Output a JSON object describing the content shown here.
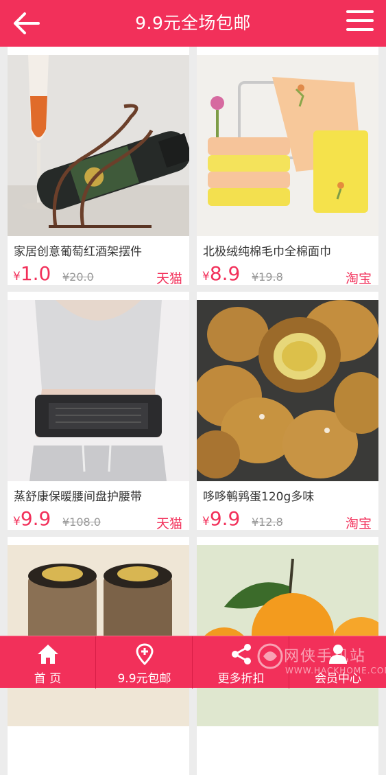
{
  "header": {
    "title": "9.9元全场包邮",
    "back_icon": "arrow-left-icon",
    "menu_icon": "hamburger-menu-icon"
  },
  "products": [
    {
      "name": "家居创意葡萄红酒架摆件",
      "currency": "¥",
      "price": "1.0",
      "old_price": "¥20.0",
      "shop": "天猫"
    },
    {
      "name": "北极绒纯棉毛巾全棉面巾",
      "currency": "¥",
      "price": "8.9",
      "old_price": "¥19.8",
      "shop": "淘宝"
    },
    {
      "name": "蒸舒康保暖腰间盘护腰带",
      "currency": "¥",
      "price": "9.9",
      "old_price": "¥108.0",
      "shop": "天猫"
    },
    {
      "name": "哆哆鹌鹑蛋120g多味",
      "currency": "¥",
      "price": "9.9",
      "old_price": "¥12.8",
      "shop": "淘宝"
    },
    {
      "name": "",
      "currency": "",
      "price": "",
      "old_price": "",
      "shop": ""
    },
    {
      "name": "",
      "currency": "",
      "price": "",
      "old_price": "",
      "shop": ""
    }
  ],
  "tabbar": {
    "items": [
      {
        "label": "首 页",
        "icon": "home-icon"
      },
      {
        "label": "9.9元包邮",
        "icon": "location-pin-icon"
      },
      {
        "label": "更多折扣",
        "icon": "share-icon"
      },
      {
        "label": "会员中心",
        "icon": "member-icon"
      }
    ]
  },
  "watermark": {
    "text": "网侠手机站",
    "url": "WWW.HACKHOME.COM"
  },
  "colors": {
    "brand": "#f2305a",
    "background": "#ececec"
  }
}
